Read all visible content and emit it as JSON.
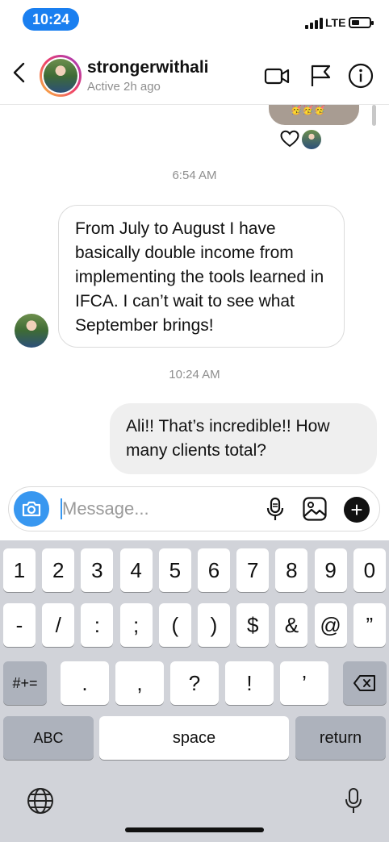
{
  "status_bar": {
    "time": "10:24",
    "network": "LTE",
    "battery_level": 0.45
  },
  "header": {
    "username": "strongerwithali",
    "status": "Active 2h ago",
    "icons": [
      "back-icon",
      "video-call-icon",
      "flag-icon",
      "info-icon"
    ]
  },
  "thread": {
    "previous_reaction": "🥳🥳🥳",
    "timestamp_1": "6:54 AM",
    "incoming_message": "From July to August I have basically double income from implementing the tools learned in IFCA. I can’t wait to see what September brings!",
    "timestamp_2": "10:24 AM",
    "outgoing_message": "Ali!! That’s incredible!! How many clients total?"
  },
  "composer": {
    "placeholder": "Message...",
    "value": "",
    "icons": [
      "camera-icon",
      "microphone-icon",
      "gallery-icon",
      "plus-icon"
    ]
  },
  "keyboard": {
    "row1": [
      "1",
      "2",
      "3",
      "4",
      "5",
      "6",
      "7",
      "8",
      "9",
      "0"
    ],
    "row2": [
      "-",
      "/",
      ":",
      ";",
      "(",
      ")",
      "$",
      "&",
      "@",
      "”"
    ],
    "row3_left": "#+=",
    "row3": [
      ".",
      ",",
      "?",
      "!",
      "’"
    ],
    "abc": "ABC",
    "space": "space",
    "return": "return"
  },
  "colors": {
    "accent": "#3897f0",
    "time_pill": "#1a7ff0",
    "bubble_out": "#efefef",
    "keyboard_bg": "#d1d3d9"
  }
}
